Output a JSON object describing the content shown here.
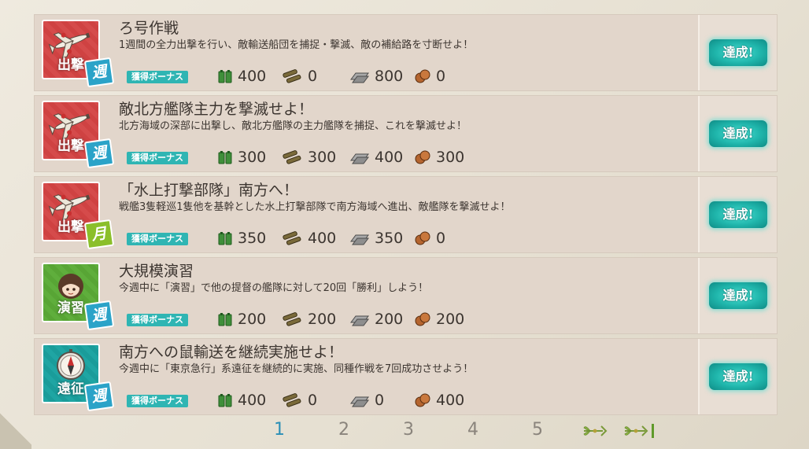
{
  "quests": [
    {
      "category": "出撃",
      "category_type": "sortie",
      "category_icon": "plane-icon",
      "frequency": "週",
      "frequency_type": "weekly",
      "title": "ろ号作戦",
      "description": "1週間の全力出撃を行い、敵輸送船団を捕捉・撃滅、敵の補給路を寸断せよ！",
      "bonus": "獲得ボーナス",
      "rewards": {
        "fuel": "400",
        "ammo": "0",
        "steel": "800",
        "bauxite": "0"
      },
      "status": "達成!"
    },
    {
      "category": "出撃",
      "category_type": "sortie",
      "category_icon": "plane-icon",
      "frequency": "週",
      "frequency_type": "weekly",
      "title": "敵北方艦隊主力を撃滅せよ！",
      "description": "北方海域の深部に出撃し、敵北方艦隊の主力艦隊を捕捉、これを撃滅せよ！",
      "bonus": "獲得ボーナス",
      "rewards": {
        "fuel": "300",
        "ammo": "300",
        "steel": "400",
        "bauxite": "300"
      },
      "status": "達成!"
    },
    {
      "category": "出撃",
      "category_type": "sortie",
      "category_icon": "plane-icon",
      "frequency": "月",
      "frequency_type": "monthly",
      "title": "「水上打撃部隊」南方へ！",
      "description": "戦艦3隻軽巡1隻他を基幹とした水上打撃部隊で南方海域へ進出、敵艦隊を撃滅せよ！",
      "bonus": "獲得ボーナス",
      "rewards": {
        "fuel": "350",
        "ammo": "400",
        "steel": "350",
        "bauxite": "0"
      },
      "status": "達成!"
    },
    {
      "category": "演習",
      "category_type": "exercise",
      "category_icon": "shipgirl-icon",
      "frequency": "週",
      "frequency_type": "weekly",
      "title": "大規模演習",
      "description": "今週中に「演習」で他の提督の艦隊に対して20回「勝利」しよう！",
      "bonus": "獲得ボーナス",
      "rewards": {
        "fuel": "200",
        "ammo": "200",
        "steel": "200",
        "bauxite": "200"
      },
      "status": "達成!"
    },
    {
      "category": "遠征",
      "category_type": "expedition",
      "category_icon": "compass-icon",
      "frequency": "週",
      "frequency_type": "weekly",
      "title": "南方への鼠輸送を継続実施せよ！",
      "description": "今週中に「東京急行」系遠征を継続的に実施、同種作戦を7回成功させよう！",
      "bonus": "獲得ボーナス",
      "rewards": {
        "fuel": "400",
        "ammo": "0",
        "steel": "0",
        "bauxite": "400"
      },
      "status": "達成!"
    }
  ],
  "pagination": {
    "pages": [
      "1",
      "2",
      "3",
      "4",
      "5"
    ],
    "current": "1"
  },
  "colors": {
    "achieved": "#1fb5ab",
    "bonus": "#2fb5b3",
    "current_page": "#2b8fb6"
  }
}
